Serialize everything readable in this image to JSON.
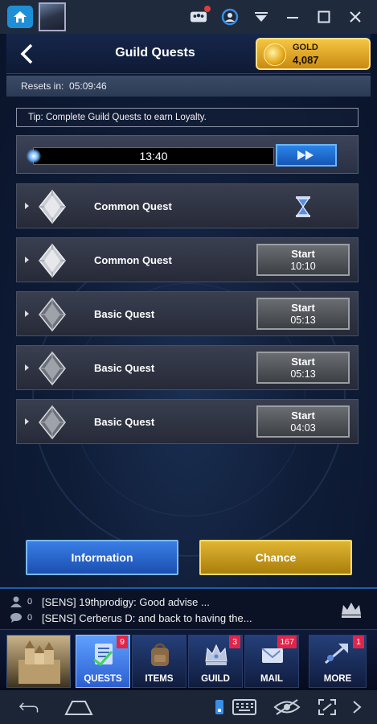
{
  "emulator": {
    "icons": [
      "home-icon",
      "game-thumbnail",
      "group-icon",
      "account-icon",
      "dropdown-icon",
      "minimize-icon",
      "maximize-icon",
      "close-icon"
    ]
  },
  "header": {
    "title": "Guild Quests",
    "gold": {
      "label": "GOLD",
      "value": "4,087"
    }
  },
  "resets": {
    "text": "Resets in:  05:09:46"
  },
  "tip": {
    "text": "Tip: Complete Guild Quests to earn Loyalty."
  },
  "timer": {
    "value": "13:40"
  },
  "quests": [
    {
      "name": "Common Quest",
      "state": "in-progress"
    },
    {
      "name": "Common Quest",
      "start_label": "Start",
      "duration": "10:10"
    },
    {
      "name": "Basic Quest",
      "start_label": "Start",
      "duration": "05:13"
    },
    {
      "name": "Basic Quest",
      "start_label": "Start",
      "duration": "05:13"
    },
    {
      "name": "Basic Quest",
      "start_label": "Start",
      "duration": "04:03"
    }
  ],
  "buttons": {
    "information": "Information",
    "chance": "Chance"
  },
  "chat": [
    {
      "count": "0",
      "text": "[SENS] 19thprodigy: Good advise ..."
    },
    {
      "count": "0",
      "text": "[SENS] Cerberus  D: and back to having the..."
    }
  ],
  "nav": [
    {
      "label": "QUESTS",
      "badge": "9"
    },
    {
      "label": "ITEMS",
      "badge": ""
    },
    {
      "label": "GUILD",
      "badge": "3"
    },
    {
      "label": "MAIL",
      "badge": "167"
    },
    {
      "label": "MORE",
      "badge": "1"
    }
  ],
  "colors": {
    "accent_blue": "#2d84e8",
    "gold": "#e0b533",
    "badge_red": "#e0254a"
  }
}
